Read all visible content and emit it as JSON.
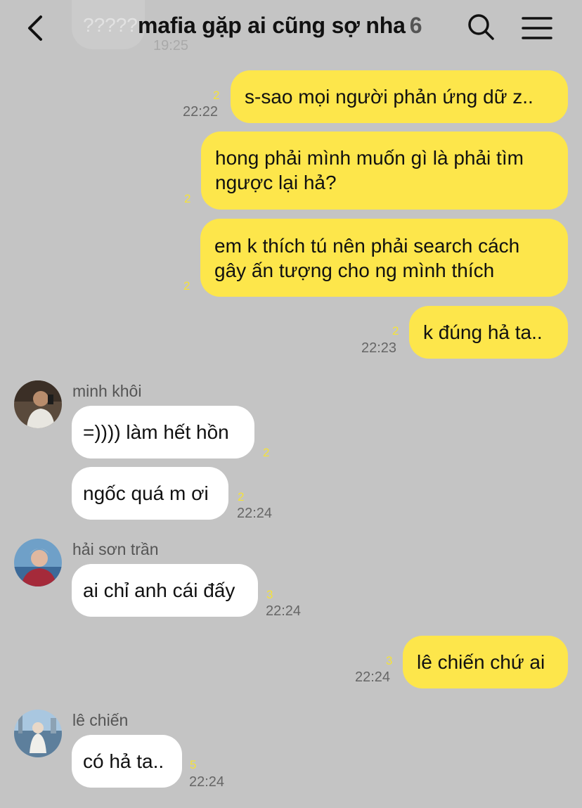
{
  "header": {
    "title": "mafia gặp ai cũng sợ nha",
    "member_count": "6"
  },
  "previous_message": {
    "text": "?????",
    "time": "19:25"
  },
  "messages": [
    {
      "from": "me",
      "text": "s-sao mọi người phản ứng dữ z..",
      "unread": "2",
      "time": "22:22"
    },
    {
      "from": "me",
      "text": "hong phải mình muốn gì là phải tìm ngược lại hả?",
      "lines": [
        "hong phải mình muốn gì là phải tìm",
        "ngược lại hả?"
      ],
      "unread": "2",
      "time": ""
    },
    {
      "from": "me",
      "text": "em k thích tú nên phải search cách gây ấn tượng cho ng mình thích",
      "lines": [
        "em k thích tú nên phải search cách",
        "gây ấn tượng cho ng mình thích"
      ],
      "unread": "2",
      "time": ""
    },
    {
      "from": "me",
      "text": "k đúng hả ta..",
      "unread": "2",
      "time": "22:23"
    },
    {
      "from": "minh khôi",
      "text": "=)))) làm hết hồn",
      "unread": "2",
      "time": ""
    },
    {
      "from": "minh khôi",
      "text": "ngốc quá m ơi",
      "unread": "2",
      "time": "22:24"
    },
    {
      "from": "hải sơn trần",
      "text": "ai chỉ anh cái đấy",
      "unread": "3",
      "time": "22:24"
    },
    {
      "from": "me",
      "text": "lê chiến chứ ai",
      "unread": "3",
      "time": "22:24"
    },
    {
      "from": "lê chiến",
      "text": "có hả ta..",
      "unread": "5",
      "time": "22:24"
    }
  ],
  "senders": {
    "minh_khoi": "minh khôi",
    "hai_son_tran": "hải sơn trần",
    "le_chien": "lê chiến"
  },
  "colors": {
    "background": "#c4c4c4",
    "my_bubble": "#fde64b",
    "other_bubble": "#ffffff",
    "unread_count": "#f4e23a"
  },
  "icons": {
    "back": "chevron-left-icon",
    "search": "search-icon",
    "menu": "hamburger-menu-icon"
  }
}
